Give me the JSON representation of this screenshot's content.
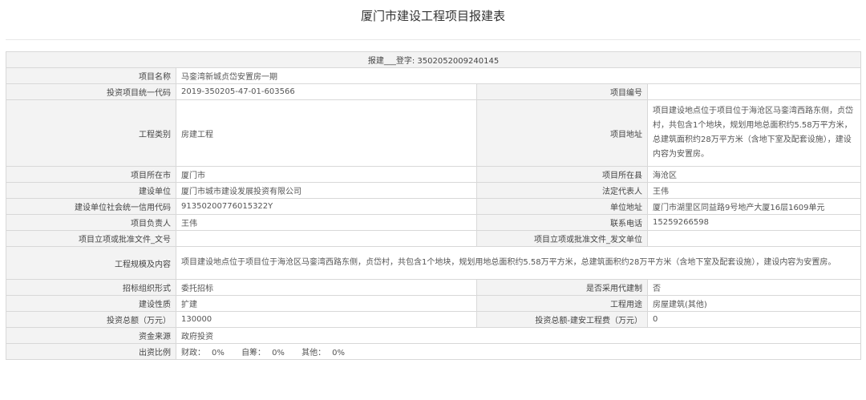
{
  "page_title": "厦门市建设工程项目报建表",
  "header_row": "报建___登字: 3502052009240145",
  "fields": {
    "project_name": {
      "label": "项目名称",
      "value": "马銮湾新城贞岱安置房一期"
    },
    "invest_code": {
      "label": "投资项目统一代码",
      "value": "2019-350205-47-01-603566"
    },
    "project_no": {
      "label": "项目编号",
      "value": ""
    },
    "project_type": {
      "label": "工程类别",
      "value": "房建工程"
    },
    "project_address": {
      "label": "项目地址",
      "value": "项目建设地点位于项目位于海沧区马銮湾西路东侧，贞岱村，共包含1个地块，规划用地总面积约5.58万平方米，总建筑面积约28万平方米（含地下室及配套设施），建设内容为安置房。"
    },
    "city": {
      "label": "项目所在市",
      "value": "厦门市"
    },
    "county": {
      "label": "项目所在县",
      "value": "海沧区"
    },
    "builder": {
      "label": "建设单位",
      "value": "厦门市城市建设发展投资有限公司"
    },
    "legal_rep": {
      "label": "法定代表人",
      "value": "王伟"
    },
    "credit_code": {
      "label": "建设单位社会统一信用代码",
      "value": "91350200776015322Y"
    },
    "unit_address": {
      "label": "单位地址",
      "value": "厦门市湖里区同益路9号地产大厦16层1609单元"
    },
    "project_lead": {
      "label": "项目负责人",
      "value": "王伟"
    },
    "phone": {
      "label": "联系电话",
      "value": "15259266598"
    },
    "approval_doc_no": {
      "label": "项目立项或批准文件_文号",
      "value": ""
    },
    "approval_doc_unit": {
      "label": "项目立项或批准文件_发文单位",
      "value": ""
    },
    "scale_content": {
      "label": "工程规模及内容",
      "value": "项目建设地点位于项目位于海沧区马銮湾西路东侧，贞岱村，共包含1个地块，规划用地总面积约5.58万平方米，总建筑面积约28万平方米（含地下室及配套设施），建设内容为安置房。"
    },
    "bid_form": {
      "label": "招标组织形式",
      "value": "委托招标"
    },
    "agent_system": {
      "label": "是否采用代建制",
      "value": "否"
    },
    "build_nature": {
      "label": "建设性质",
      "value": "扩建"
    },
    "usage": {
      "label": "工程用途",
      "value": "房屋建筑(其他)"
    },
    "total_invest": {
      "label": "投资总额（万元）",
      "value": "130000"
    },
    "install_cost": {
      "label": "投资总额-建安工程费（万元）",
      "value": "0"
    },
    "fund_source": {
      "label": "资金来源",
      "value": "政府投资"
    },
    "fund_ratio": {
      "label": "出资比例",
      "finance_label": "财政：",
      "finance_value": "0%",
      "self_label": "自筹：",
      "self_value": "0%",
      "other_label": "其他：",
      "other_value": "0%"
    }
  }
}
